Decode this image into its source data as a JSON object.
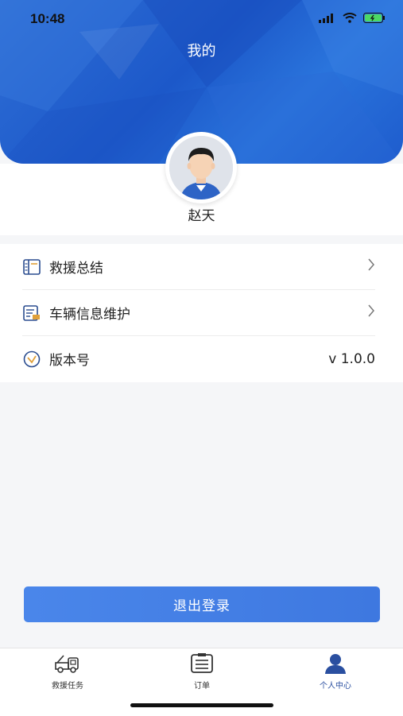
{
  "status_bar": {
    "time": "10:48"
  },
  "header": {
    "title": "我的"
  },
  "profile": {
    "name": "赵天"
  },
  "menu": {
    "items": [
      {
        "label": "救援总结",
        "icon": "book-icon",
        "right": ">"
      },
      {
        "label": "车辆信息维护",
        "icon": "document-edit-icon",
        "right": ">"
      },
      {
        "label": "版本号",
        "icon": "version-check-icon",
        "right": "v 1.0.0"
      }
    ]
  },
  "logout": {
    "label": "退出登录"
  },
  "tabbar": {
    "tabs": [
      {
        "label": "救援任务",
        "icon": "tow-truck-icon",
        "active": false
      },
      {
        "label": "订单",
        "icon": "clipboard-list-icon",
        "active": false
      },
      {
        "label": "个人中心",
        "icon": "user-icon",
        "active": true
      }
    ]
  },
  "colors": {
    "header_blue": "#1f5fd0",
    "button_blue": "#4580e6",
    "active_tab": "#2a4fa0"
  }
}
